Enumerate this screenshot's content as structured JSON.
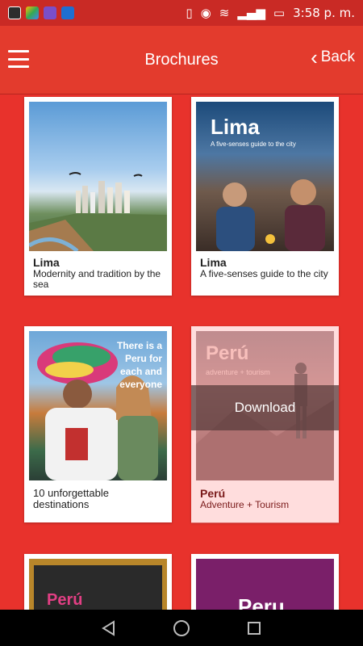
{
  "status": {
    "time": "3:58 p. m.",
    "icons": [
      "voicemail-icon",
      "drive-icon",
      "gallery-icon",
      "outlook-icon"
    ],
    "right_icons": [
      "vibrate-icon",
      "eye-icon",
      "wifi-icon",
      "signal-icon",
      "battery-icon"
    ]
  },
  "header": {
    "title": "Brochures",
    "back_label": "Back"
  },
  "cards": [
    {
      "title": "Lima",
      "subtitle": "Modernity and tradition by the sea",
      "cover": "sky"
    },
    {
      "title": "Lima",
      "subtitle": "A five-senses guide to the city",
      "cover_title": "Lima",
      "cover_sub": "A five-senses guide to the city",
      "cover": "night"
    },
    {
      "title": "",
      "subtitle": "10 unforgettable destinations",
      "cover_text": "There is a Peru for each and everyone",
      "cover": "festival"
    },
    {
      "title": "Perú",
      "subtitle": "Adventure + Tourism",
      "cover_title": "Perú",
      "cover_sub": "adventure + tourism",
      "cover": "mountain",
      "action": "Download"
    },
    {
      "cover_title": "Perú",
      "cover": "frame"
    },
    {
      "cover_title": "Peru",
      "cover": "purple"
    }
  ],
  "colors": {
    "accent": "#e33b2d",
    "status": "#c92a25",
    "background": "#e8322c"
  },
  "nav": {
    "icons": [
      "back-triangle-icon",
      "home-circle-icon",
      "recents-square-icon"
    ]
  }
}
